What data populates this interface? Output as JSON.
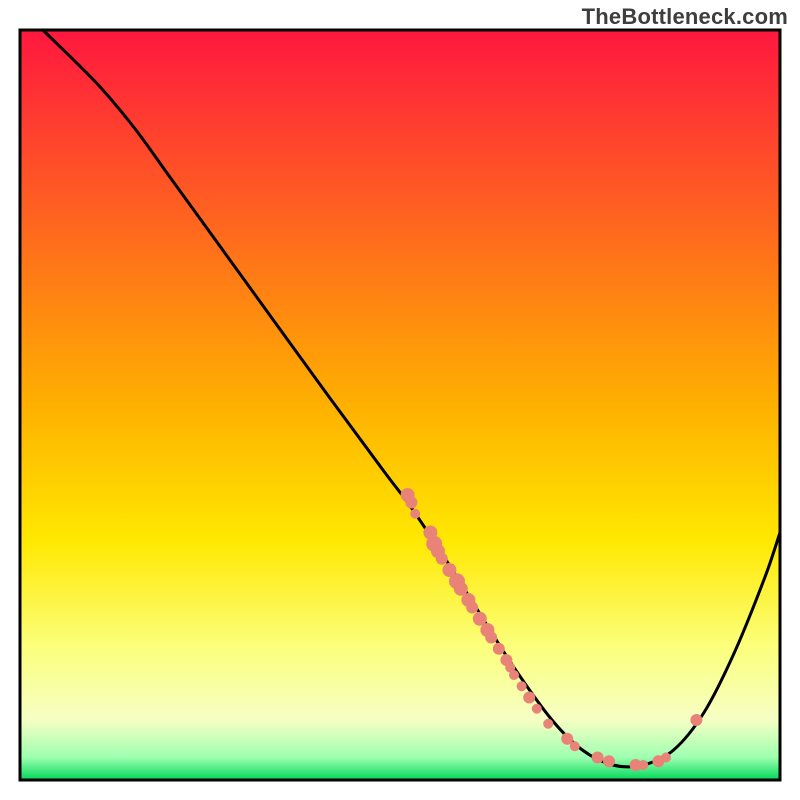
{
  "watermark": "TheBottleneck.com",
  "colors": {
    "curve": "#000000",
    "dot": "#e98378",
    "dot_stroke": "#d06a60",
    "frame": "#000000",
    "top": "#ff173f",
    "mid": "#ffe800",
    "bottom_yellow": "#fbff7a",
    "bottom_cream": "#f6ffc4",
    "green": "#00d85a"
  },
  "chart_data": {
    "type": "line",
    "title": "",
    "xlabel": "",
    "ylabel": "",
    "xlim": [
      0,
      100
    ],
    "ylim": [
      0,
      100
    ],
    "curve": [
      {
        "x": 3,
        "y": 100
      },
      {
        "x": 10,
        "y": 93
      },
      {
        "x": 15,
        "y": 87
      },
      {
        "x": 20,
        "y": 80
      },
      {
        "x": 30,
        "y": 66
      },
      {
        "x": 40,
        "y": 52
      },
      {
        "x": 48,
        "y": 41
      },
      {
        "x": 51,
        "y": 37
      },
      {
        "x": 55,
        "y": 31
      },
      {
        "x": 60,
        "y": 23
      },
      {
        "x": 65,
        "y": 15
      },
      {
        "x": 70,
        "y": 8
      },
      {
        "x": 74,
        "y": 4
      },
      {
        "x": 78,
        "y": 2
      },
      {
        "x": 82,
        "y": 2
      },
      {
        "x": 86,
        "y": 4
      },
      {
        "x": 90,
        "y": 9
      },
      {
        "x": 94,
        "y": 17
      },
      {
        "x": 98,
        "y": 27
      },
      {
        "x": 100,
        "y": 33
      }
    ],
    "dots": [
      {
        "x": 51,
        "y": 38,
        "r": 7
      },
      {
        "x": 51.5,
        "y": 37,
        "r": 6
      },
      {
        "x": 52,
        "y": 35.5,
        "r": 5
      },
      {
        "x": 54,
        "y": 33,
        "r": 7
      },
      {
        "x": 54.5,
        "y": 31.5,
        "r": 8
      },
      {
        "x": 55,
        "y": 30.5,
        "r": 7
      },
      {
        "x": 55.5,
        "y": 29.5,
        "r": 6
      },
      {
        "x": 56.5,
        "y": 28,
        "r": 7
      },
      {
        "x": 57.5,
        "y": 26.5,
        "r": 8
      },
      {
        "x": 58,
        "y": 25.5,
        "r": 7
      },
      {
        "x": 59,
        "y": 24,
        "r": 7
      },
      {
        "x": 59.5,
        "y": 23,
        "r": 6
      },
      {
        "x": 60.5,
        "y": 21.5,
        "r": 7
      },
      {
        "x": 61.5,
        "y": 20,
        "r": 7
      },
      {
        "x": 62,
        "y": 19,
        "r": 6
      },
      {
        "x": 63,
        "y": 17.5,
        "r": 6
      },
      {
        "x": 64,
        "y": 16,
        "r": 6
      },
      {
        "x": 64.5,
        "y": 15,
        "r": 5
      },
      {
        "x": 65,
        "y": 14,
        "r": 5
      },
      {
        "x": 66,
        "y": 12.5,
        "r": 5
      },
      {
        "x": 67,
        "y": 11,
        "r": 6
      },
      {
        "x": 68,
        "y": 9.5,
        "r": 5
      },
      {
        "x": 69.5,
        "y": 7.5,
        "r": 5
      },
      {
        "x": 72,
        "y": 5.5,
        "r": 6
      },
      {
        "x": 73,
        "y": 4.5,
        "r": 5
      },
      {
        "x": 76,
        "y": 3,
        "r": 6
      },
      {
        "x": 77.5,
        "y": 2.5,
        "r": 6
      },
      {
        "x": 81,
        "y": 2,
        "r": 6
      },
      {
        "x": 82,
        "y": 2,
        "r": 5
      },
      {
        "x": 84,
        "y": 2.5,
        "r": 6
      },
      {
        "x": 85,
        "y": 3,
        "r": 5
      },
      {
        "x": 89,
        "y": 8,
        "r": 6
      }
    ]
  }
}
